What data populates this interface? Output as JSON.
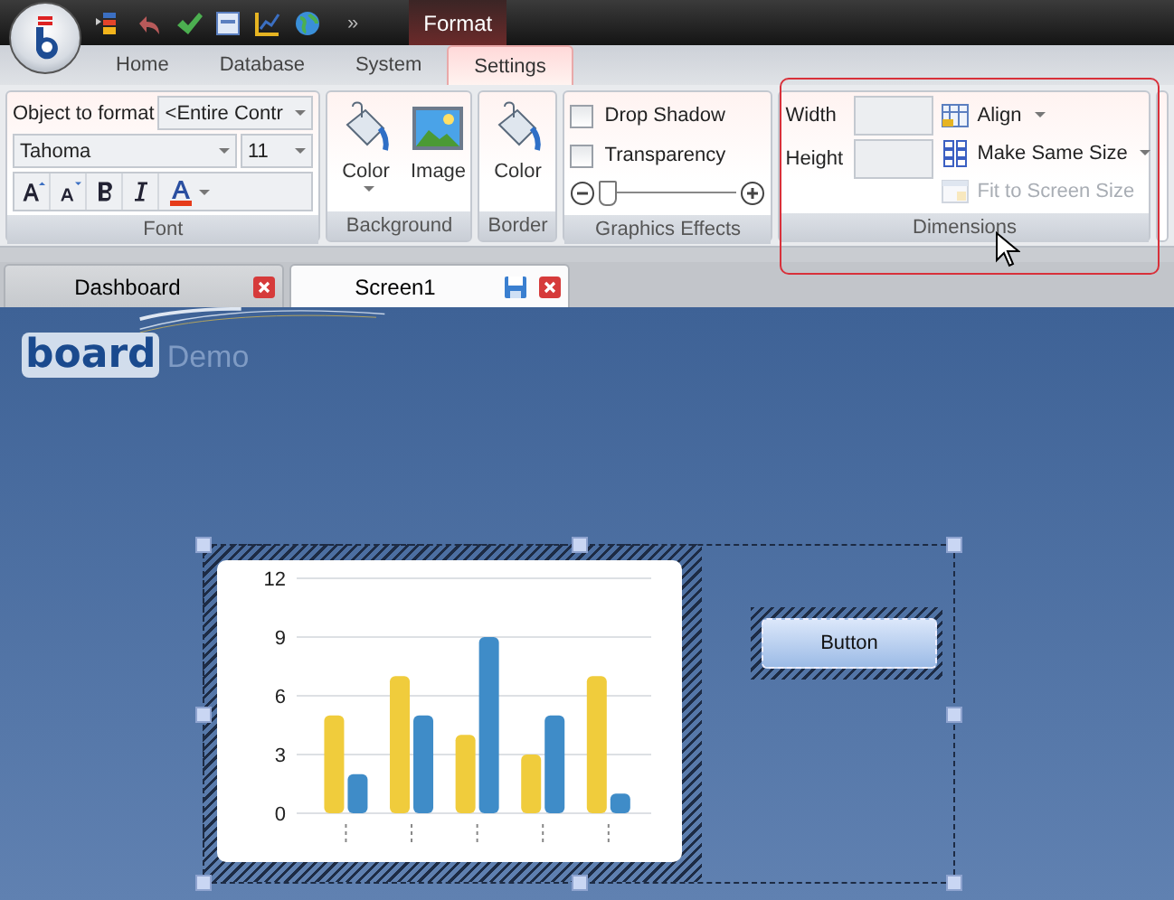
{
  "quick_access": {
    "overflow": "»"
  },
  "context_title": "Format",
  "tabs": [
    {
      "label": "Home",
      "selected": false
    },
    {
      "label": "Database",
      "selected": false
    },
    {
      "label": "System",
      "selected": false
    },
    {
      "label": "Settings",
      "selected": true
    }
  ],
  "font_group": {
    "object_label": "Object to format",
    "object_value": "<Entire Contr",
    "font_name": "Tahoma",
    "font_size": "11",
    "title": "Font"
  },
  "background_group": {
    "buttons": [
      "Color",
      "Image"
    ],
    "title": "Background"
  },
  "border_group": {
    "buttons": [
      "Color"
    ],
    "title": "Border"
  },
  "effects_group": {
    "options": [
      {
        "label": "Drop Shadow",
        "checked": false
      },
      {
        "label": "Transparency",
        "checked": false
      }
    ],
    "level": 0.05,
    "title": "Graphics Effects"
  },
  "dimensions_group": {
    "width_label": "Width",
    "height_label": "Height",
    "actions": [
      {
        "kind": "align",
        "label": "Align",
        "disabled": false,
        "dropdown": true
      },
      {
        "kind": "same-size",
        "label": "Make Same Size",
        "disabled": false,
        "dropdown": true
      },
      {
        "kind": "fit",
        "label": "Fit to Screen Size",
        "disabled": true,
        "dropdown": false
      }
    ],
    "title": "Dimensions"
  },
  "doc_tabs": [
    {
      "label": "Dashboard",
      "selected": false,
      "saveable": false
    },
    {
      "label": "Screen1",
      "selected": true,
      "saveable": true
    }
  ],
  "canvas": {
    "logo": "board",
    "logo_suffix": "Demo",
    "button": "Button",
    "chart_data": {
      "type": "bar",
      "grid": true,
      "ylim": [
        0,
        12
      ],
      "yticks": [
        0,
        3,
        6,
        9,
        12
      ],
      "series": [
        {
          "color": "#f0cc3c",
          "values": [
            5,
            7,
            4,
            3,
            7
          ]
        },
        {
          "color": "#3f8cc8",
          "values": [
            2,
            5,
            9,
            5,
            1
          ]
        }
      ]
    }
  }
}
